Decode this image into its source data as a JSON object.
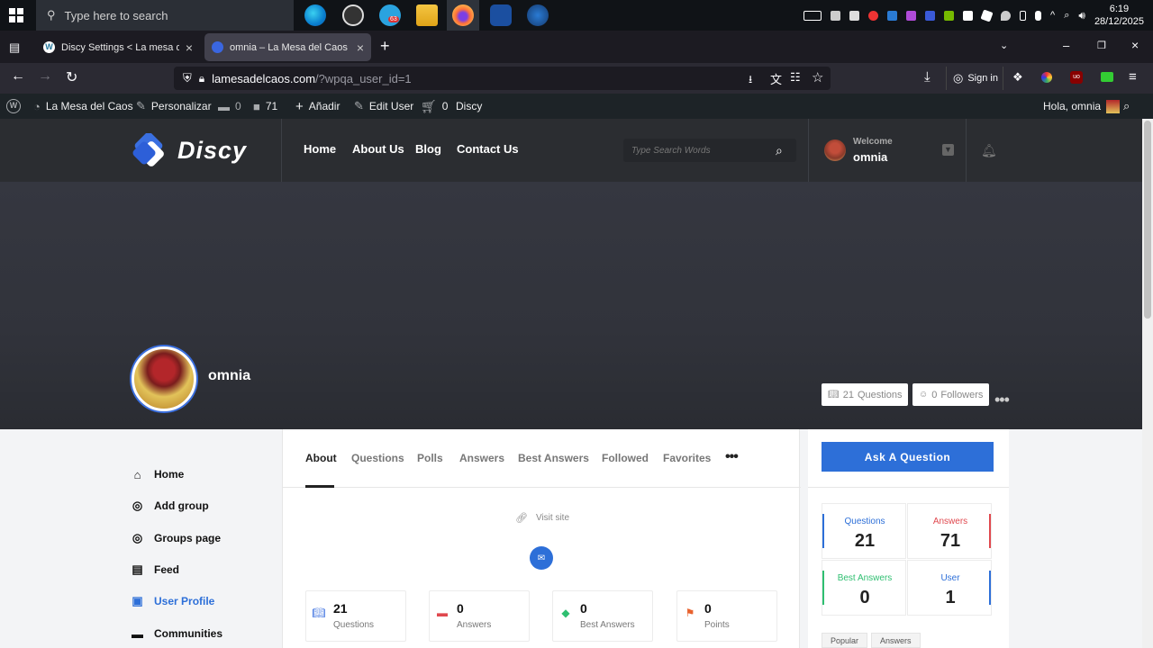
{
  "taskbar": {
    "search_placeholder": "Type here to search",
    "clock_time": "6:19",
    "clock_date": "28/12/2025",
    "telegram_badge": "63"
  },
  "browser": {
    "tabs": [
      {
        "title": "Discy Settings < La mesa del Caos",
        "active": false
      },
      {
        "title": "omnia – La Mesa del Caos",
        "active": true
      }
    ],
    "url_host": "lamesadelcaos.com",
    "url_path": "/?wpqa_user_id=1",
    "sign_in_label": "Sign in"
  },
  "adminbar": {
    "site_name": "La Mesa del Caos",
    "customize_label": "Personalizar",
    "comments_count": "0",
    "discussions_count": "71",
    "add_label": "Añadir",
    "edit_user_label": "Edit User",
    "cart_count": "0",
    "theme_label": "Discy",
    "greeting": "Hola, omnia"
  },
  "header": {
    "logo_text": "Discy",
    "menu": [
      "Home",
      "About Us",
      "Blog",
      "Contact Us"
    ],
    "search_placeholder": "Type Search Words",
    "welcome_label": "Welcome",
    "user_name": "omnia"
  },
  "profile": {
    "name": "omnia",
    "questions_chip_count": "21",
    "questions_chip_label": "Questions",
    "followers_chip_count": "0",
    "followers_chip_label": "Followers"
  },
  "left_nav": [
    "Home",
    "Add group",
    "Groups page",
    "Feed",
    "User Profile",
    "Communities"
  ],
  "profile_tabs": [
    "About",
    "Questions",
    "Polls",
    "Answers",
    "Best Answers",
    "Followed",
    "Favorites"
  ],
  "about": {
    "visit_site_label": "Visit site",
    "cards": [
      {
        "num": "21",
        "label": "Questions"
      },
      {
        "num": "0",
        "label": "Answers"
      },
      {
        "num": "0",
        "label": "Best Answers"
      },
      {
        "num": "0",
        "label": "Points"
      }
    ]
  },
  "sidebar": {
    "ask_button": "Ask A Question",
    "stats": [
      {
        "label": "Questions",
        "value": "21",
        "color": "#2d6fd8"
      },
      {
        "label": "Answers",
        "value": "71",
        "color": "#e0484e"
      },
      {
        "label": "Best Answers",
        "value": "0",
        "color": "#2fbf71"
      },
      {
        "label": "User",
        "value": "1",
        "color": "#2d6fd8"
      }
    ],
    "tabs": [
      "Popular",
      "Answers"
    ]
  }
}
